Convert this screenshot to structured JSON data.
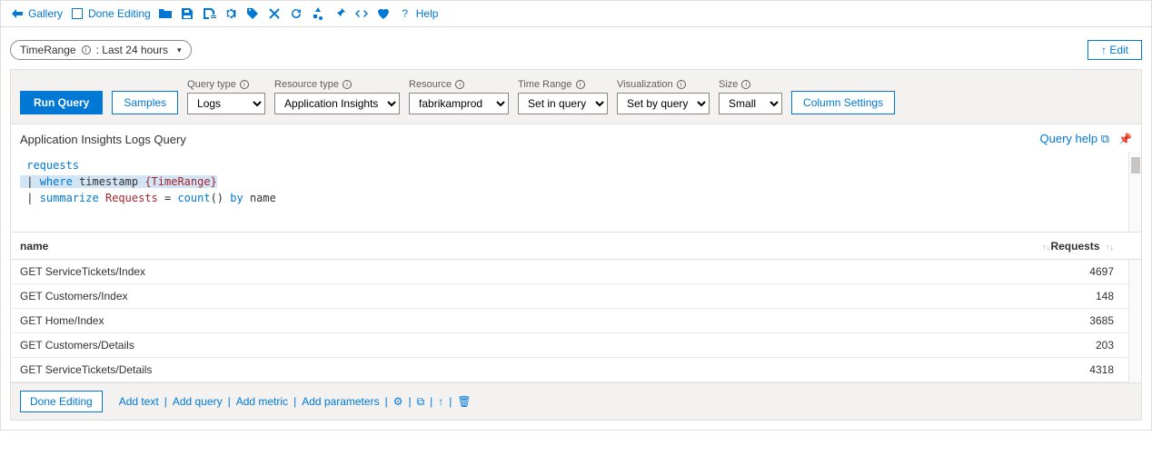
{
  "toolbar": {
    "gallery": "Gallery",
    "done_editing": "Done Editing",
    "help": "Help"
  },
  "params": {
    "timerange_label": "TimeRange",
    "timerange_value": ": Last 24 hours",
    "edit": "↑ Edit"
  },
  "querybar": {
    "run": "Run Query",
    "samples": "Samples",
    "column_settings": "Column Settings",
    "fields": {
      "query_type": {
        "label": "Query type",
        "value": "Logs"
      },
      "resource_type": {
        "label": "Resource type",
        "value": "Application Insights"
      },
      "resource": {
        "label": "Resource",
        "value": "fabrikamprod"
      },
      "time_range": {
        "label": "Time Range",
        "value": "Set in query"
      },
      "visualization": {
        "label": "Visualization",
        "value": "Set by query"
      },
      "size": {
        "label": "Size",
        "value": "Small"
      }
    }
  },
  "editor": {
    "title": "Application Insights Logs Query",
    "help": "Query help",
    "line1_kw": "requests",
    "line2_pipe": "|",
    "line2_where": "where",
    "line2_col": "timestamp",
    "line2_param": "{TimeRange}",
    "line3_pipe": "|",
    "line3_summarize": "summarize",
    "line3_alias": "Requests",
    "line3_eq": " = ",
    "line3_count": "count",
    "line3_paren": "()",
    "line3_by": "by",
    "line3_col": "name"
  },
  "results": {
    "columns": {
      "name": "name",
      "requests": "Requests"
    },
    "rows": [
      {
        "name": "GET ServiceTickets/Index",
        "requests": "4697"
      },
      {
        "name": "GET Customers/Index",
        "requests": "148"
      },
      {
        "name": "GET Home/Index",
        "requests": "3685"
      },
      {
        "name": "GET Customers/Details",
        "requests": "203"
      },
      {
        "name": "GET ServiceTickets/Details",
        "requests": "4318"
      }
    ]
  },
  "footer": {
    "done": "Done Editing",
    "add_text": "Add text",
    "add_query": "Add query",
    "add_metric": "Add metric",
    "add_parameters": "Add parameters"
  }
}
